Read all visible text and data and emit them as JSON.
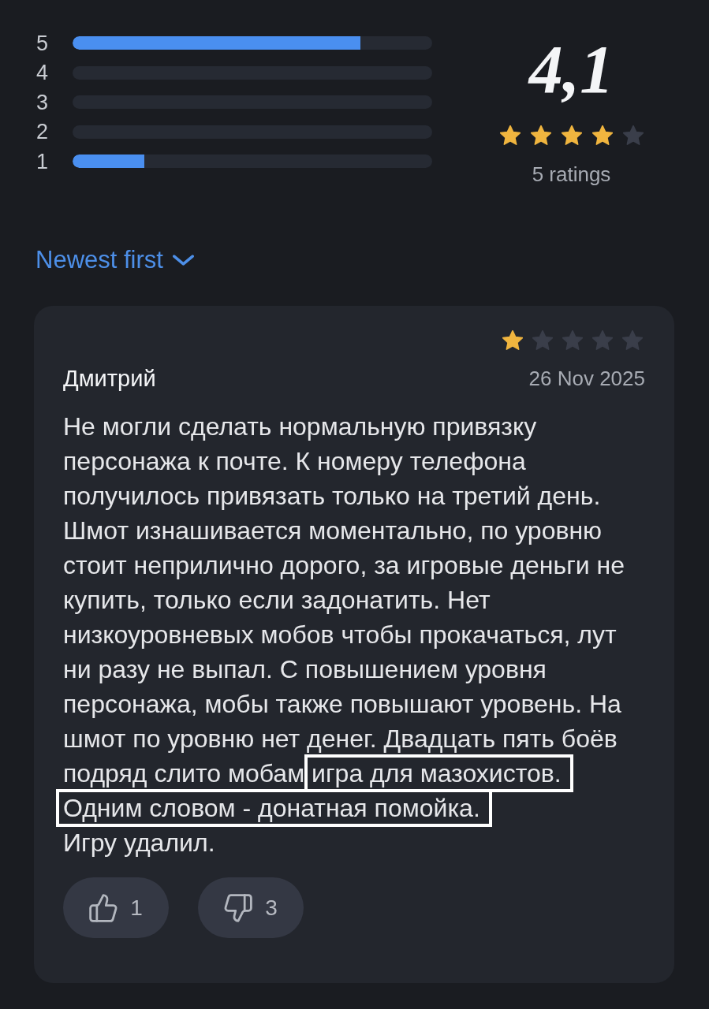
{
  "histogram": [
    {
      "label": "5",
      "level": 0.8
    },
    {
      "label": "4",
      "level": 0
    },
    {
      "label": "3",
      "level": 0
    },
    {
      "label": "2",
      "level": 0
    },
    {
      "label": "1",
      "level": 0.2
    }
  ],
  "summary": {
    "score": "4,1",
    "stars": 4,
    "count": "5 ratings"
  },
  "sort": {
    "label": "Newest first"
  },
  "review": {
    "stars": 1,
    "author": "Дмитрий",
    "date": "26 Nov 2025",
    "paragraphs": [
      [
        {
          "text": "Не могли сделать нормальную привязку персонажа к почте. К номеру телефона получилось привязать только на третий день. Шмот изнашивается моментально, по уровню стоит неприлично дорого, за игровые деньги не купить, только если задонатить. Нет низкоуровневых мобов чтобы прокачаться, лут ни разу не выпал. С повышением уровня персонажа, мобы также повышают уровень. На шмот по уровню нет денег. Двадцать пять боёв подряд слито мобам",
          "highlighted": false
        },
        {
          "text": "игра для мазохистов.",
          "highlighted": true
        },
        {
          "text": "Одним словом - донатная помойка.",
          "highlighted": true
        }
      ],
      [
        {
          "text": "Игру удалил.",
          "highlighted": false
        }
      ]
    ],
    "reactions": [
      {
        "kind": "like",
        "count": "1"
      },
      {
        "kind": "dislike",
        "count": "3"
      }
    ]
  }
}
